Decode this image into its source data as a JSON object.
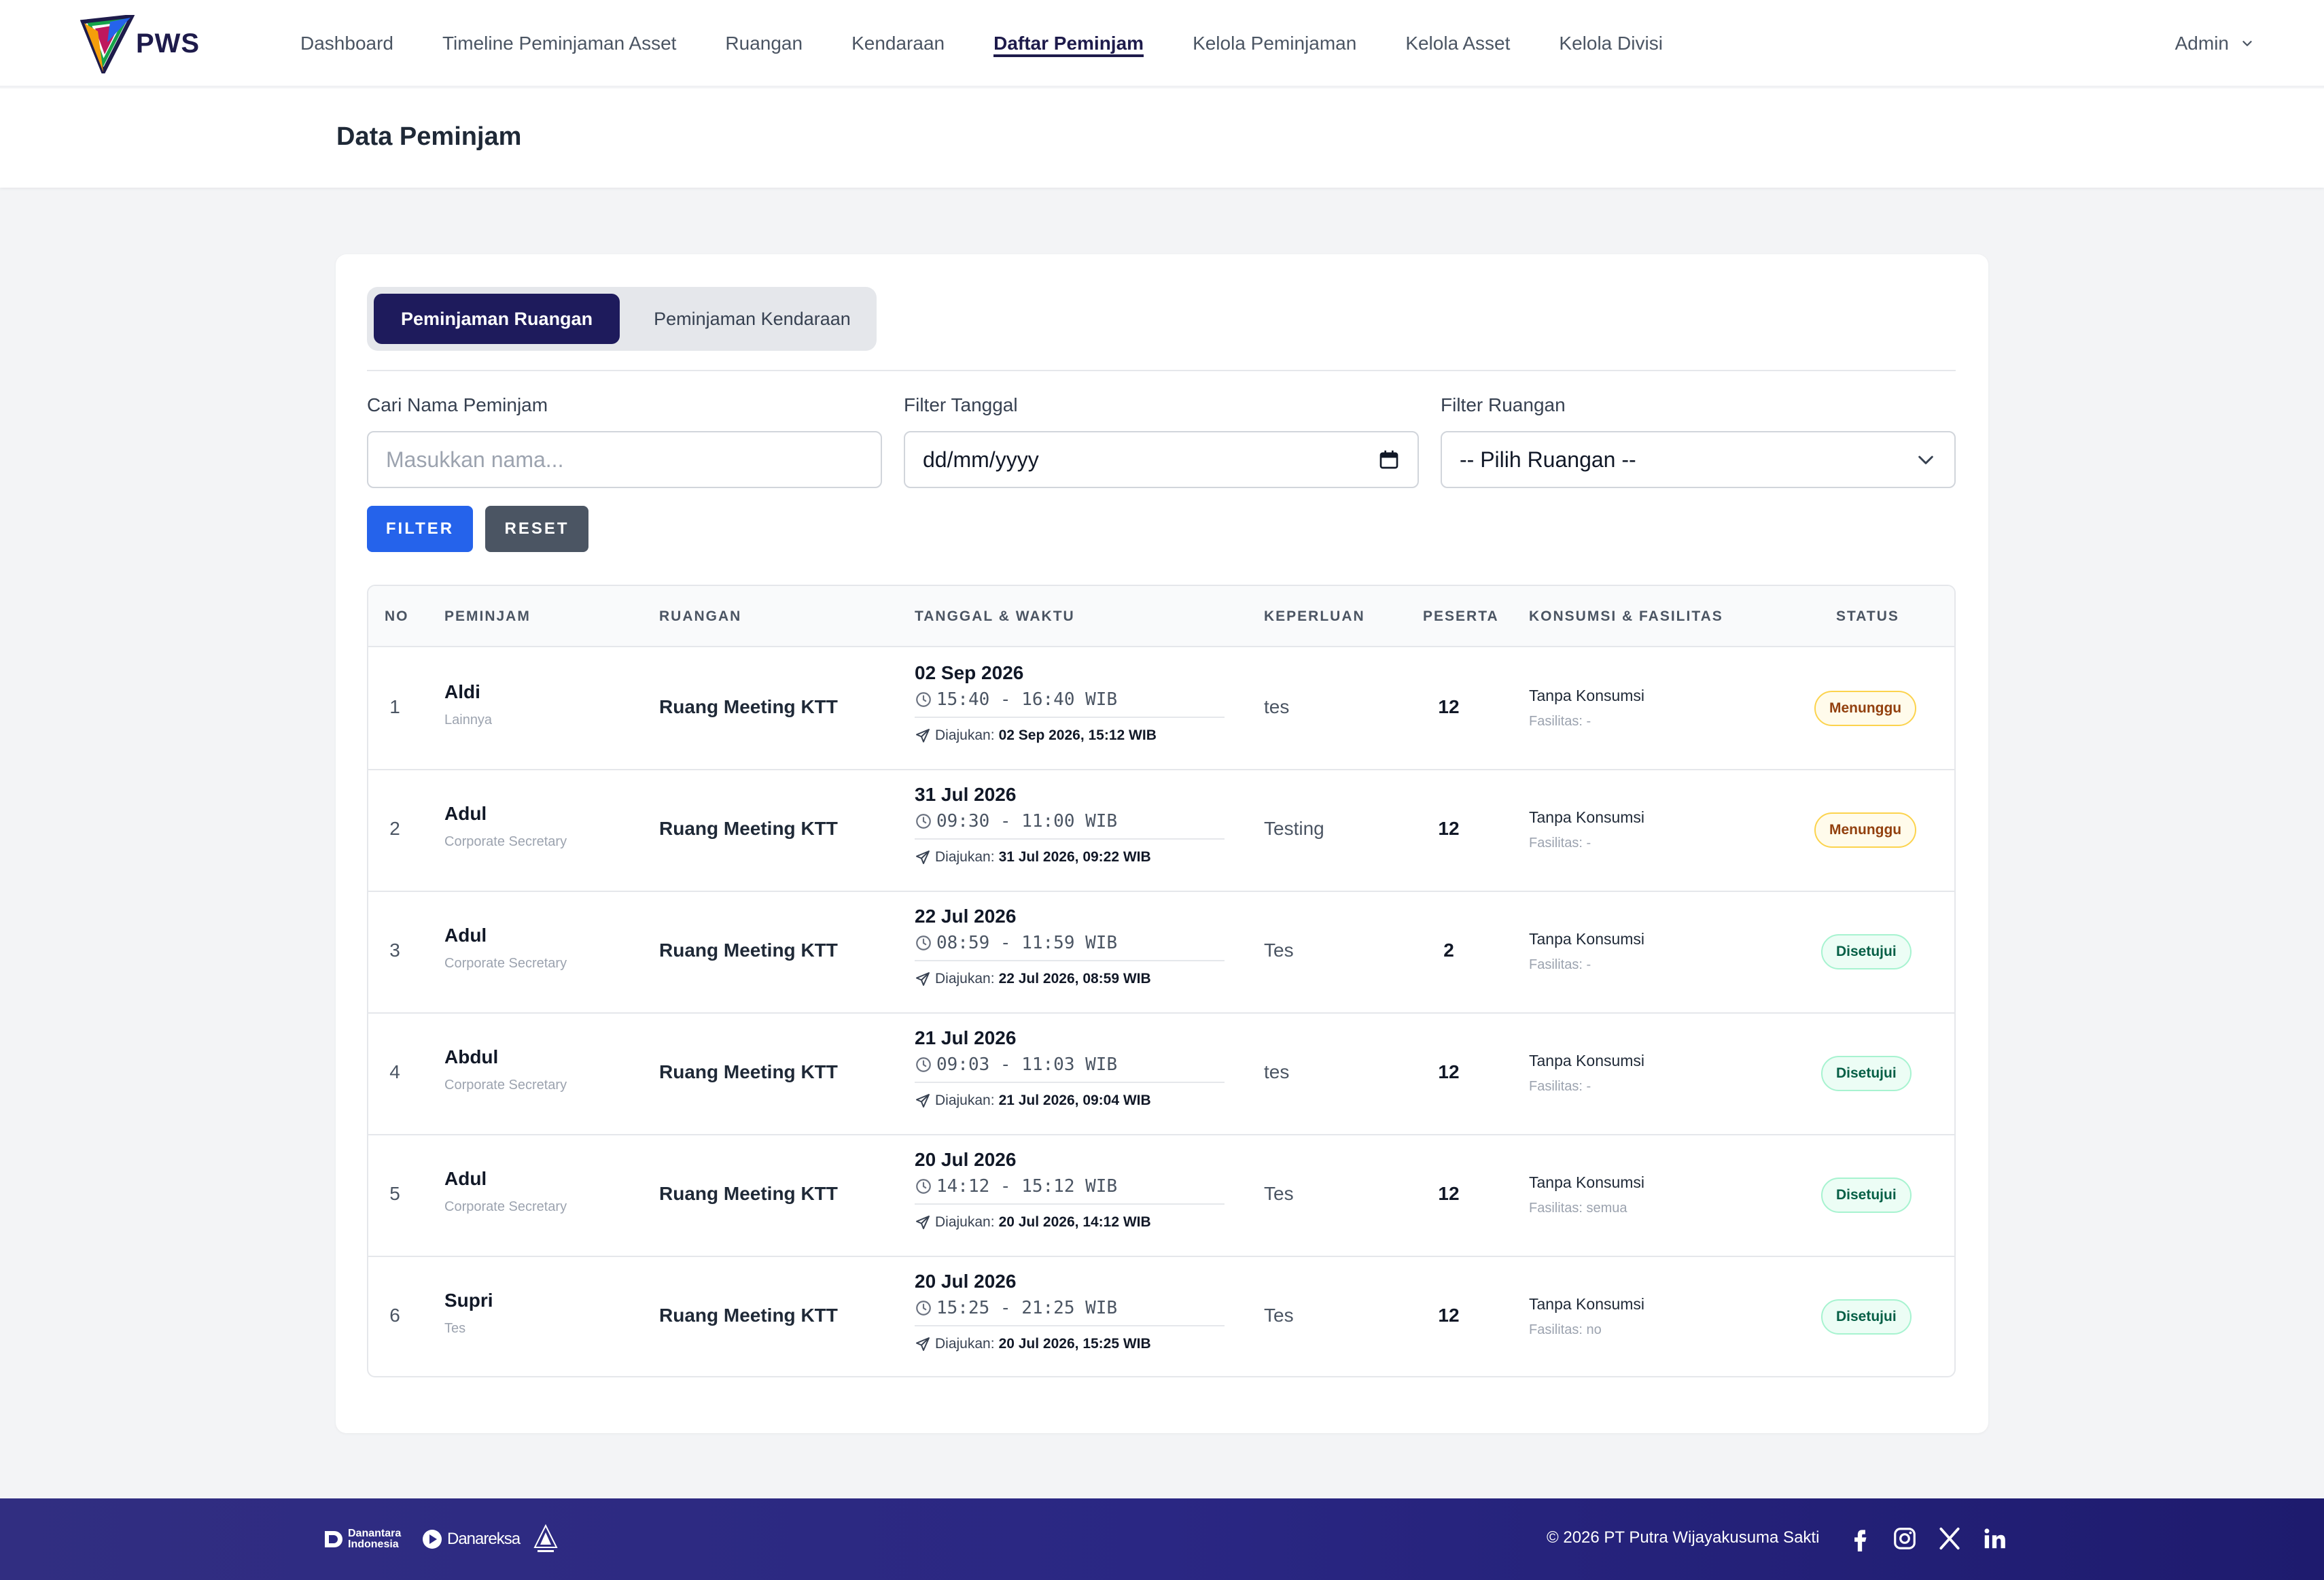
{
  "nav": {
    "brand": "PWS",
    "links": [
      "Dashboard",
      "Timeline Peminjaman Asset",
      "Ruangan",
      "Kendaraan",
      "Daftar Peminjam",
      "Kelola Peminjaman",
      "Kelola Asset",
      "Kelola Divisi"
    ],
    "active": "Daftar Peminjam",
    "user": "Admin"
  },
  "page": {
    "title": "Data Peminjam"
  },
  "tabs": [
    "Peminjaman Ruangan",
    "Peminjaman Kendaraan"
  ],
  "filters": {
    "name_label": "Cari Nama Peminjam",
    "name_placeholder": "Masukkan nama...",
    "date_label": "Filter Tanggal",
    "date_value": "dd/mm/yyyy",
    "room_label": "Filter Ruangan",
    "room_value": "-- Pilih Ruangan --",
    "filter_btn": "FILTER",
    "reset_btn": "RESET"
  },
  "table": {
    "headers": [
      "NO",
      "PEMINJAM",
      "RUANGAN",
      "TANGGAL & WAKTU",
      "KEPERLUAN",
      "PESERTA",
      "KONSUMSI & FASILITAS",
      "STATUS"
    ],
    "submitted_prefix": "Diajukan:",
    "rows": [
      {
        "no": "1",
        "name": "Aldi",
        "dept": "Lainnya",
        "room": "Ruang Meeting KTT",
        "date": "02 Sep 2026",
        "time": "15:40 - 16:40 WIB",
        "submitted": "02 Sep 2026, 15:12 WIB",
        "purpose": "tes",
        "participants": "12",
        "consumption": "Tanpa Konsumsi",
        "facility": "Fasilitas: -",
        "status": "Menunggu",
        "status_type": "wait"
      },
      {
        "no": "2",
        "name": "Adul",
        "dept": "Corporate Secretary",
        "room": "Ruang Meeting KTT",
        "date": "31 Jul 2026",
        "time": "09:30 - 11:00 WIB",
        "submitted": "31 Jul 2026, 09:22 WIB",
        "purpose": "Testing",
        "participants": "12",
        "consumption": "Tanpa Konsumsi",
        "facility": "Fasilitas: -",
        "status": "Menunggu",
        "status_type": "wait"
      },
      {
        "no": "3",
        "name": "Adul",
        "dept": "Corporate Secretary",
        "room": "Ruang Meeting KTT",
        "date": "22 Jul 2026",
        "time": "08:59 - 11:59 WIB",
        "submitted": "22 Jul 2026, 08:59 WIB",
        "purpose": "Tes",
        "participants": "2",
        "consumption": "Tanpa Konsumsi",
        "facility": "Fasilitas: -",
        "status": "Disetujui",
        "status_type": "ok"
      },
      {
        "no": "4",
        "name": "Abdul",
        "dept": "Corporate Secretary",
        "room": "Ruang Meeting KTT",
        "date": "21 Jul 2026",
        "time": "09:03 - 11:03 WIB",
        "submitted": "21 Jul 2026, 09:04 WIB",
        "purpose": "tes",
        "participants": "12",
        "consumption": "Tanpa Konsumsi",
        "facility": "Fasilitas: -",
        "status": "Disetujui",
        "status_type": "ok"
      },
      {
        "no": "5",
        "name": "Adul",
        "dept": "Corporate Secretary",
        "room": "Ruang Meeting KTT",
        "date": "20 Jul 2026",
        "time": "14:12 - 15:12 WIB",
        "submitted": "20 Jul 2026, 14:12 WIB",
        "purpose": "Tes",
        "participants": "12",
        "consumption": "Tanpa Konsumsi",
        "facility": "Fasilitas: semua",
        "status": "Disetujui",
        "status_type": "ok"
      },
      {
        "no": "6",
        "name": "Supri",
        "dept": "Tes",
        "room": "Ruang Meeting KTT",
        "date": "20 Jul 2026",
        "time": "15:25 - 21:25 WIB",
        "submitted": "20 Jul 2026, 15:25 WIB",
        "purpose": "Tes",
        "participants": "12",
        "consumption": "Tanpa Konsumsi",
        "facility": "Fasilitas: no",
        "status": "Disetujui",
        "status_type": "ok"
      }
    ]
  },
  "footer": {
    "partners": [
      "Danantara Indonesia",
      "Danareksa"
    ],
    "copyright": "© 2026 PT Putra Wijayakusuma Sakti",
    "socials": [
      "facebook-icon",
      "instagram-icon",
      "x-icon",
      "linkedin-icon"
    ]
  },
  "colors": {
    "primary": "#1e1b5c",
    "filter": "#2563eb",
    "reset": "#4b5563",
    "footer": "#2a2783"
  }
}
